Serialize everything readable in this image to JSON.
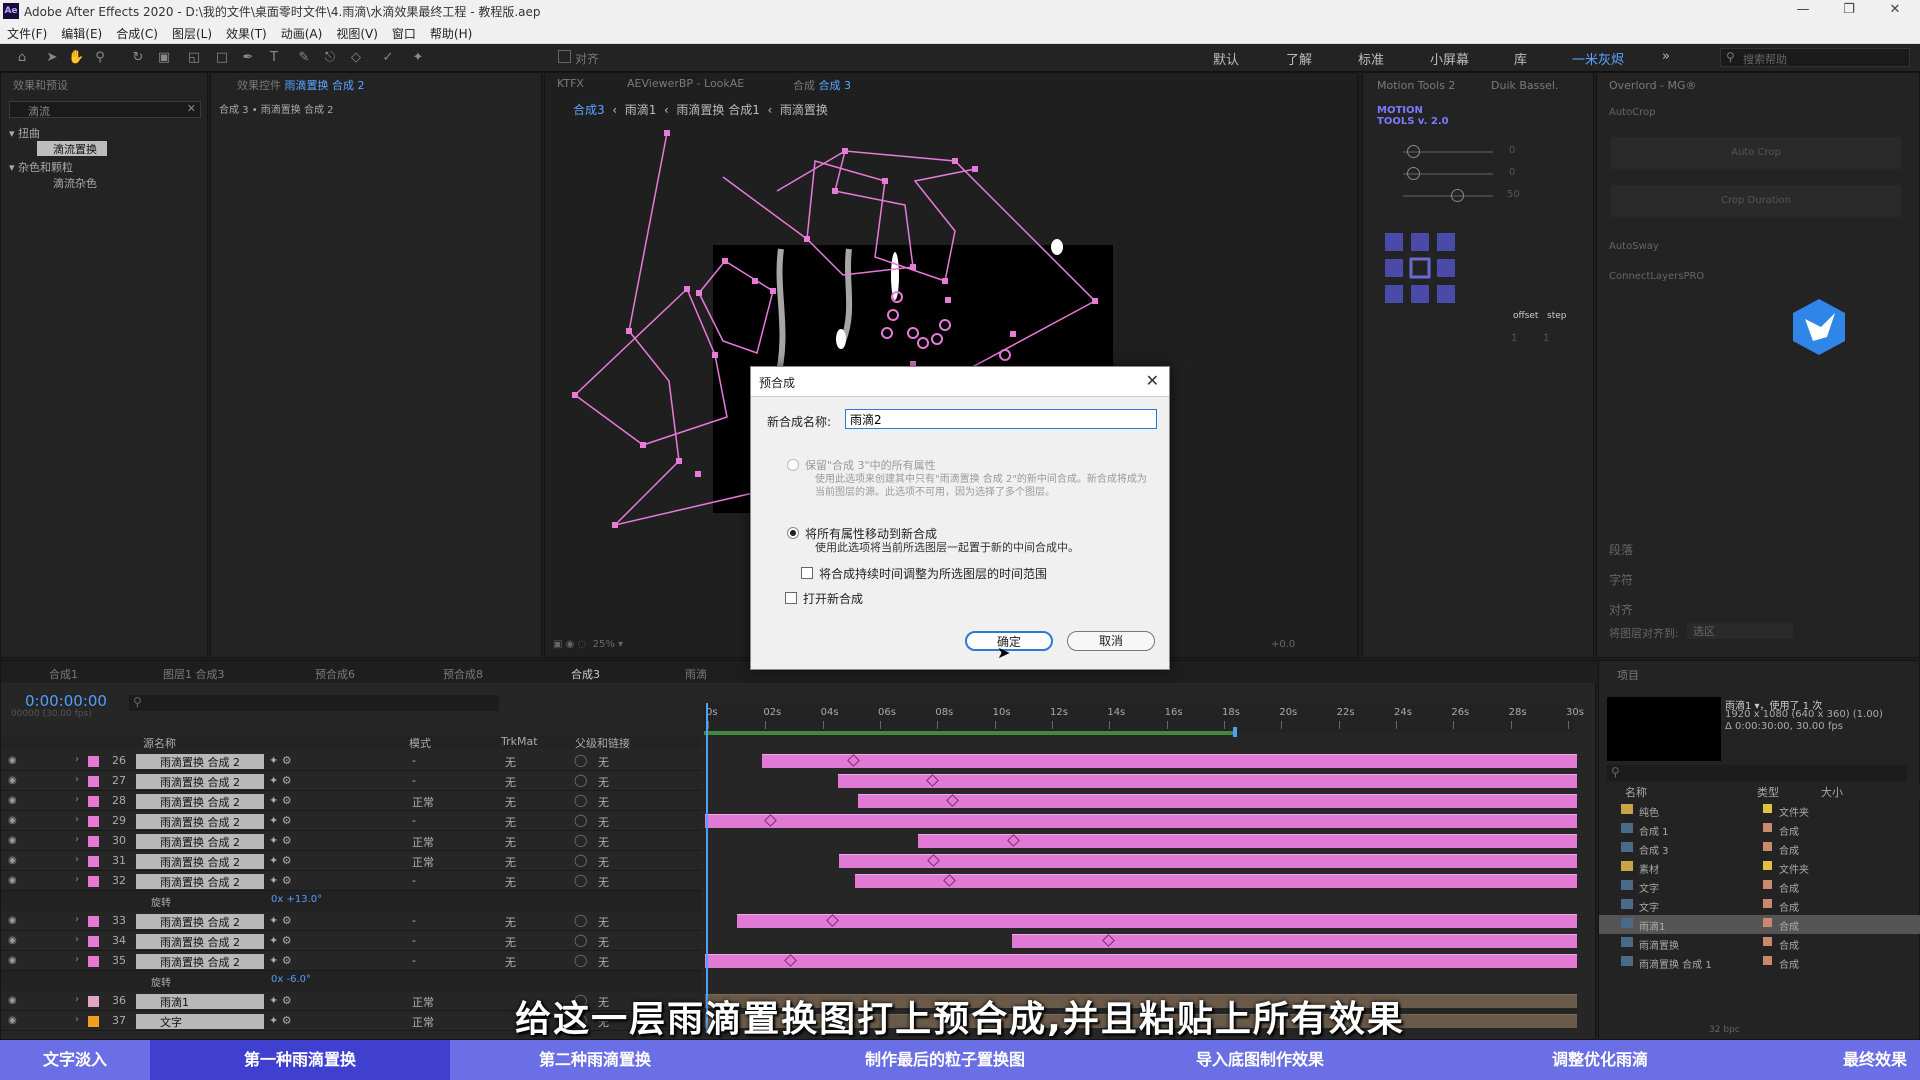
{
  "titlebar": {
    "title": "Adobe After Effects 2020 - D:\\我的文件\\桌面零时文件\\4.雨滴\\水滴效果最终工程 - 教程版.aep",
    "logo": "Ae"
  },
  "menu": [
    "文件(F)",
    "编辑(E)",
    "合成(C)",
    "图层(L)",
    "效果(T)",
    "动画(A)",
    "视图(V)",
    "窗口",
    "帮助(H)"
  ],
  "toolbar": {
    "align_label": "对齐"
  },
  "workspaces": [
    "默认",
    "了解",
    "标准",
    "小屏幕",
    "库",
    "一米灰烬"
  ],
  "workspace_active": "一米灰烬",
  "search_help_placeholder": "搜索帮助",
  "effects_panel": {
    "tab": "效果和预设",
    "search": "滴流",
    "categories": [
      {
        "name": "扭曲",
        "items": [
          "滴流置换"
        ]
      },
      {
        "name": "杂色和颗粒",
        "items": [
          "滴流杂色"
        ]
      }
    ]
  },
  "effect_controls": {
    "tab_prefix": "效果控件",
    "tab_target": "雨滴置换 合成 2",
    "breadcrumb": "合成 3 • 雨滴置换 合成 2"
  },
  "comp_tabs": {
    "tabs": [
      "KTFX",
      "AEViewerBP - LookAE"
    ],
    "active_prefix": "合成",
    "active": "合成 3",
    "breadcrumbs": [
      "合成3",
      "雨滴1",
      "雨滴置换 合成1",
      "雨滴置换"
    ]
  },
  "comp_view_footer": {
    "zoom": "25%",
    "exposure": "+0.0"
  },
  "motion_tools": {
    "tabs": [
      "Motion Tools 2",
      "Duik Bassel."
    ],
    "logo_line1": "MOTION",
    "logo_line2": "TOOLS v. 2.0",
    "values": [
      "0",
      "0",
      "50"
    ],
    "labels": [
      "offset",
      "step"
    ],
    "counters": [
      "1",
      "1"
    ]
  },
  "overlord_panel": {
    "tabs": [
      "Overlord - MG®"
    ],
    "items": [
      "AutoCrop",
      "Auto Crop",
      "Crop Duration",
      "AutoSway",
      "ConnectLayersPRO"
    ]
  },
  "side_panels": {
    "items": [
      "段落",
      "字符",
      "对齐"
    ],
    "align_to_label": "将图层对齐到:",
    "align_to_value": "选区"
  },
  "dialog": {
    "title": "预合成",
    "name_label": "新合成名称:",
    "name_value": "雨滴2",
    "option1_label": "保留\"合成 3\"中的所有属性",
    "option1_desc": "使用此选项来创建其中只有\"雨滴置换 合成 2\"的新中间合成。新合成将成为当前图层的源。此选项不可用，因为选择了多个图层。",
    "option2_label": "将所有属性移动到新合成",
    "option2_desc": "使用此选项将当前所选图层一起置于新的中间合成中。",
    "adjust_duration_label": "将合成持续时间调整为所选图层的时间范围",
    "open_new_label": "打开新合成",
    "ok_label": "确定",
    "cancel_label": "取消"
  },
  "timeline": {
    "tabs": [
      "合成1",
      "图层1 合成3",
      "预合成6",
      "预合成8",
      "合成3",
      "雨滴"
    ],
    "active_tab": "合成3",
    "timecode": "0:00:00:00",
    "frame_info": "00000 (30.00 fps)",
    "columns": {
      "source_name": "源名称",
      "mode": "模式",
      "trkmat": "TrkMat",
      "parent": "父级和链接"
    },
    "ruler": [
      "0s",
      "02s",
      "04s",
      "06s",
      "08s",
      "10s",
      "12s",
      "14s",
      "16s",
      "18s",
      "20s",
      "22s",
      "24s",
      "26s",
      "28s",
      "30s"
    ],
    "layers": [
      {
        "num": "26",
        "name": "雨滴置换 合成 2",
        "mode": "-",
        "trk": "无",
        "parent": "无",
        "start": 0.065,
        "key": 0.17
      },
      {
        "num": "27",
        "name": "雨滴置换 合成 2",
        "mode": "-",
        "trk": "无",
        "parent": "无",
        "start": 0.152,
        "key": 0.26
      },
      {
        "num": "28",
        "name": "雨滴置换 合成 2",
        "mode": "正常",
        "trk": "无",
        "parent": "无",
        "start": 0.175,
        "key": 0.283
      },
      {
        "num": "29",
        "name": "雨滴置换 合成 2",
        "mode": "-",
        "trk": "无",
        "parent": "无",
        "start": 0.0,
        "key": 0.075
      },
      {
        "num": "30",
        "name": "雨滴置换 合成 2",
        "mode": "正常",
        "trk": "无",
        "parent": "无",
        "start": 0.244,
        "key": 0.353
      },
      {
        "num": "31",
        "name": "雨滴置换 合成 2",
        "mode": "正常",
        "trk": "无",
        "parent": "无",
        "start": 0.154,
        "key": 0.262
      },
      {
        "num": "32",
        "name": "雨滴置换 合成 2",
        "mode": "-",
        "trk": "无",
        "parent": "无",
        "start": 0.172,
        "key": 0.28
      },
      {
        "num": "33",
        "name": "雨滴置换 合成 2",
        "mode": "-",
        "trk": "无",
        "parent": "无",
        "start": 0.037,
        "key": 0.146
      },
      {
        "num": "34",
        "name": "雨滴置换 合成 2",
        "mode": "-",
        "trk": "无",
        "parent": "无",
        "start": 0.352,
        "key": 0.462
      },
      {
        "num": "35",
        "name": "雨滴置换 合成 2",
        "mode": "-",
        "trk": "无",
        "parent": "无",
        "start": 0.0,
        "key": 0.098
      },
      {
        "num": "36",
        "name": "雨滴1",
        "mode": "正常",
        "trk": "",
        "parent": "无",
        "start": 0.0,
        "key": -1
      },
      {
        "num": "37",
        "name": "文字",
        "mode": "正常",
        "trk": "",
        "parent": "无",
        "start": 0.0,
        "key": -1
      }
    ],
    "rotation_label": "旋转",
    "rotation_values": [
      "0x +13.0°",
      "0x -6.0°"
    ]
  },
  "project_panel": {
    "tab": "项目",
    "selected_name": "雨滴1 ▾，使用了 1 次",
    "resolution": "1920 x 1080  (640 x 360) (1.00)",
    "duration": "Δ 0:00:30:00, 30.00 fps",
    "columns": [
      "名称",
      "类型",
      "大小"
    ],
    "items": [
      {
        "name": "纯色",
        "type": "文件夹"
      },
      {
        "name": "合成 1",
        "type": "合成"
      },
      {
        "name": "合成 3",
        "type": "合成"
      },
      {
        "name": "素材",
        "type": "文件夹"
      },
      {
        "name": "文字",
        "type": "合成"
      },
      {
        "name": "文字",
        "type": "合成"
      },
      {
        "name": "雨滴1",
        "type": "合成"
      },
      {
        "name": "雨滴置换",
        "type": "合成"
      },
      {
        "name": "雨滴置换 合成 1",
        "type": "合成"
      }
    ],
    "bpc": "32 bpc"
  },
  "subtitle": "给这一层雨滴置换图打上预合成,并且粘贴上所有效果",
  "chapters": [
    "文字淡入",
    "第一种雨滴置换",
    "第二种雨滴置换",
    "制作最后的粒子置换图",
    "导入底图制作效果",
    "调整优化雨滴",
    "最终效果"
  ],
  "colors": {
    "layer_pink": "#e17ad5",
    "accent_blue": "#5aa4ff",
    "chapter_bar": "#6b6fe6",
    "chapter_active": "#3f3fd0"
  }
}
